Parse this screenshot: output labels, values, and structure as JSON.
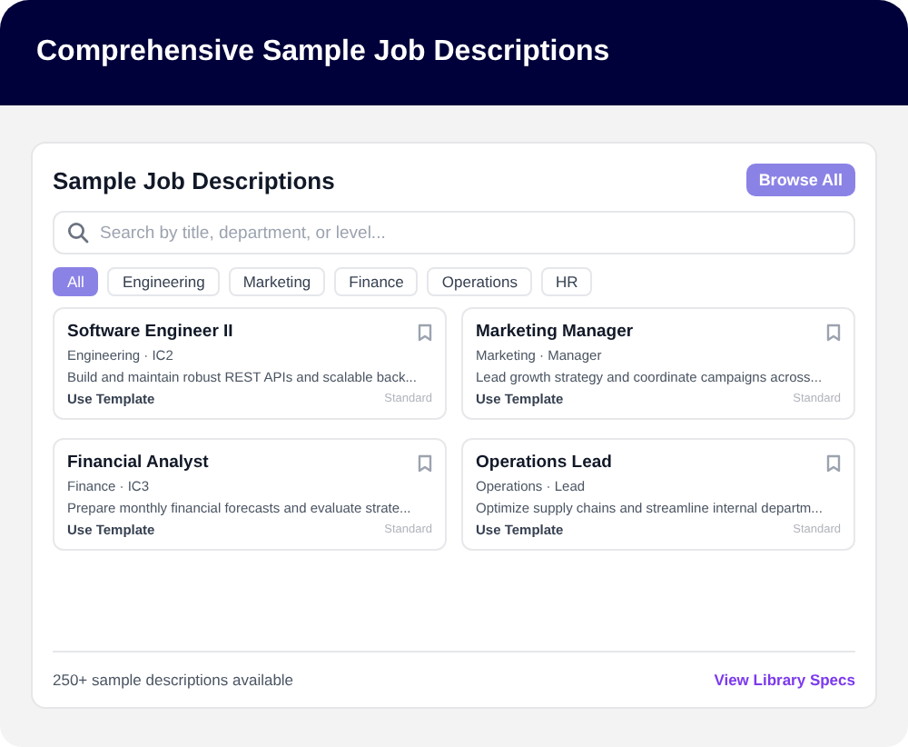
{
  "header": {
    "title": "Comprehensive Sample Job Descriptions"
  },
  "panel": {
    "title": "Sample Job Descriptions",
    "browse_button": "Browse All",
    "search": {
      "placeholder": "Search by title, department, or level..."
    },
    "filters": [
      {
        "label": "All",
        "selected": true
      },
      {
        "label": "Engineering",
        "selected": false
      },
      {
        "label": "Marketing",
        "selected": false
      },
      {
        "label": "Finance",
        "selected": false
      },
      {
        "label": "Operations",
        "selected": false
      },
      {
        "label": "HR",
        "selected": false
      }
    ],
    "jobs": [
      {
        "title": "Software Engineer II",
        "meta": "Engineering · IC2",
        "description": "Build and maintain robust REST APIs and scalable back...",
        "action": "Use Template",
        "tag": "Standard"
      },
      {
        "title": "Marketing Manager",
        "meta": "Marketing · Manager",
        "description": "Lead growth strategy and coordinate campaigns across...",
        "action": "Use Template",
        "tag": "Standard"
      },
      {
        "title": "Financial Analyst",
        "meta": "Finance · IC3",
        "description": "Prepare monthly financial forecasts and evaluate strate...",
        "action": "Use Template",
        "tag": "Standard"
      },
      {
        "title": "Operations Lead",
        "meta": "Operations · Lead",
        "description": "Optimize supply chains and streamline internal departm...",
        "action": "Use Template",
        "tag": "Standard"
      }
    ],
    "footer": {
      "note": "250+ sample descriptions available",
      "link": "View Library Specs"
    }
  }
}
